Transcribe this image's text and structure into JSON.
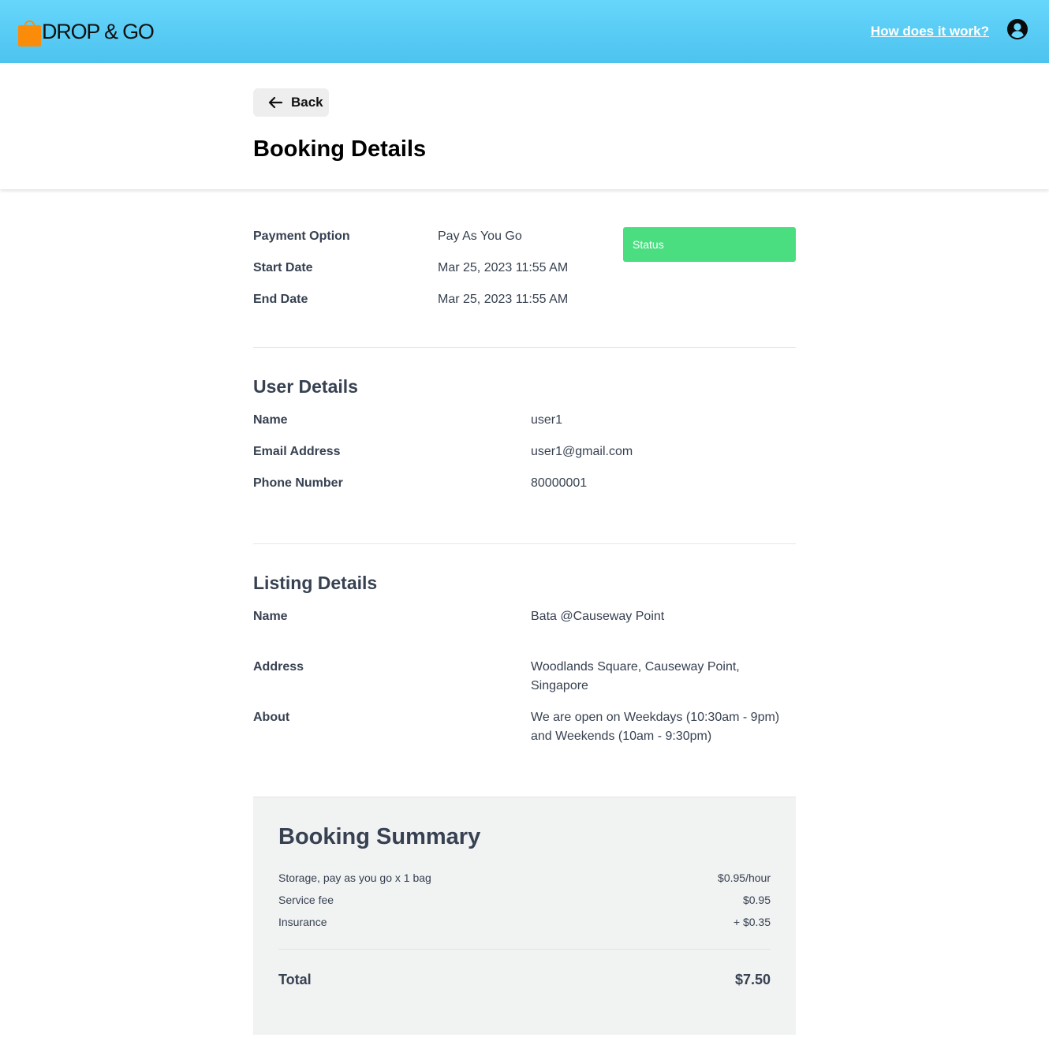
{
  "brand": {
    "name": "DROP & GO",
    "accent": "#fb8c0a",
    "header_color": "#4cc3ef"
  },
  "nav": {
    "how_it_works": "How does it work?",
    "profile_icon": "user-circle-icon"
  },
  "header": {
    "back_label": "Back",
    "title": "Booking Details"
  },
  "booking": {
    "payment_option_label": "Payment Option",
    "payment_option_value": "Pay As You Go",
    "start_date_label": "Start Date",
    "start_date_value": "Mar 25, 2023 11:55 AM",
    "end_date_label": "End Date",
    "end_date_value": "Mar 25, 2023 11:55 AM",
    "status_label": "Status",
    "status_color": "#4ade80"
  },
  "user_details": {
    "title": "User Details",
    "name_label": "Name",
    "name_value": "user1",
    "email_label": "Email Address",
    "email_value": "user1@gmail.com",
    "phone_label": "Phone Number",
    "phone_value": "80000001"
  },
  "listing_details": {
    "title": "Listing Details",
    "name_label": "Name",
    "name_value": "Bata @Causeway Point",
    "address_label": "Address",
    "address_value": "Woodlands Square, Causeway Point, Singapore",
    "about_label": "About",
    "about_value": "We are open on Weekdays (10:30am - 9pm) and Weekends (10am - 9:30pm)"
  },
  "summary": {
    "title": "Booking Summary",
    "items": [
      {
        "label": "Storage, pay as you go x 1 bag",
        "value": "$0.95/hour"
      },
      {
        "label": "Service fee",
        "value": "$0.95"
      },
      {
        "label": "Insurance",
        "value": "+ $0.35"
      }
    ],
    "total_label": "Total",
    "total_value": "$7.50"
  }
}
